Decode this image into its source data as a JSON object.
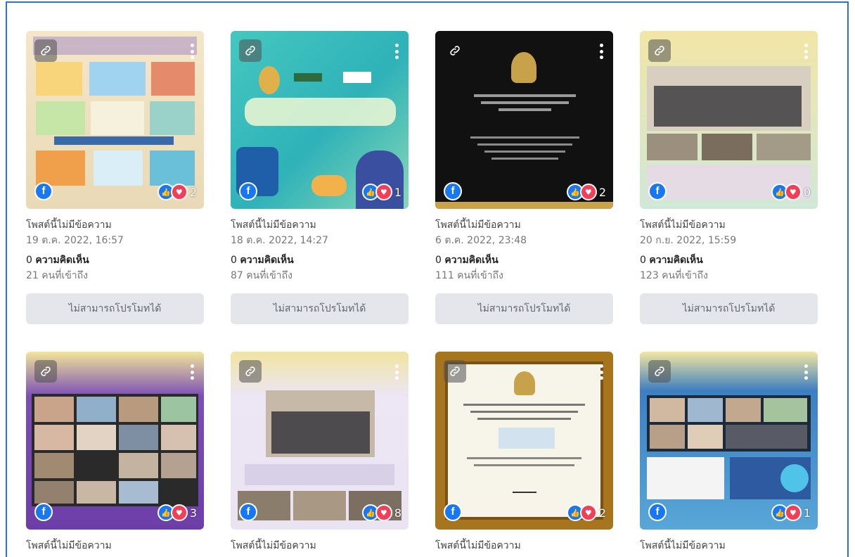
{
  "posts": [
    {
      "title": "โพสต์นี้ไม่มีข้อความ",
      "date": "19 ต.ค. 2022, 16:57",
      "comments_count": "0",
      "comments_label": "ความคิดเห็น",
      "reach": "21 คนที่เข้าถึง",
      "reactions": "2",
      "promote": "ไม่สามารถโปรโมทได้"
    },
    {
      "title": "โพสต์นี้ไม่มีข้อความ",
      "date": "18 ต.ค. 2022, 14:27",
      "comments_count": "0",
      "comments_label": "ความคิดเห็น",
      "reach": "87 คนที่เข้าถึง",
      "reactions": "1",
      "promote": "ไม่สามารถโปรโมทได้"
    },
    {
      "title": "โพสต์นี้ไม่มีข้อความ",
      "date": "6 ต.ค. 2022, 23:48",
      "comments_count": "0",
      "comments_label": "ความคิดเห็น",
      "reach": "111 คนที่เข้าถึง",
      "reactions": "2",
      "promote": "ไม่สามารถโปรโมทได้"
    },
    {
      "title": "โพสต์นี้ไม่มีข้อความ",
      "date": "20 ก.ย. 2022, 15:59",
      "comments_count": "0",
      "comments_label": "ความคิดเห็น",
      "reach": "123 คนที่เข้าถึง",
      "reactions": "0",
      "promote": "ไม่สามารถโปรโมทได้"
    },
    {
      "title": "โพสต์นี้ไม่มีข้อความ",
      "reactions": "3"
    },
    {
      "title": "โพสต์นี้ไม่มีข้อความ",
      "reactions": "8"
    },
    {
      "title": "โพสต์นี้ไม่มีข้อความ",
      "reactions": "2"
    },
    {
      "title": "โพสต์นี้ไม่มีข้อความ",
      "reactions": "1"
    }
  ],
  "icons": {
    "link": "link-icon",
    "more": "more-vertical-icon",
    "facebook": "facebook-icon",
    "like": "like-icon",
    "love": "love-icon"
  },
  "colors": {
    "frame": "#2d74c5",
    "facebook": "#1877f2",
    "love": "#f33e58",
    "button_bg": "#e4e6eb"
  }
}
